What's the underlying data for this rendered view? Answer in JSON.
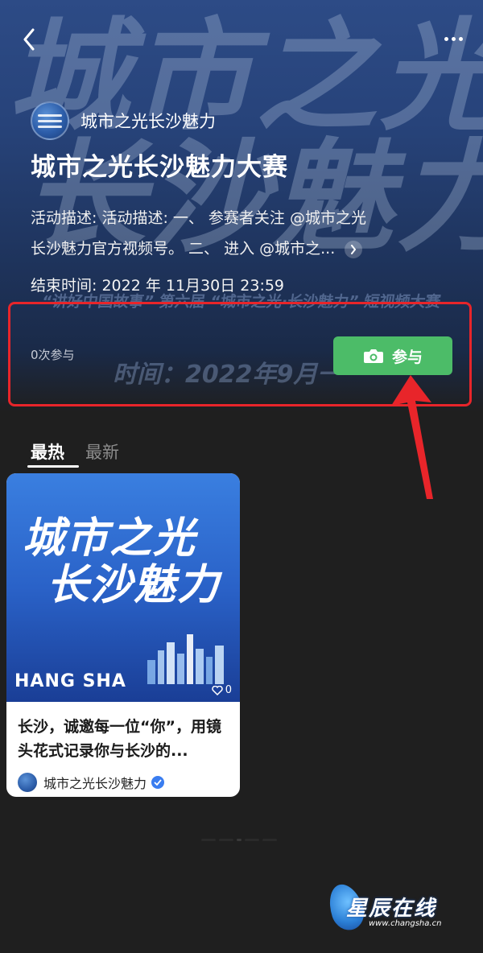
{
  "hero": {
    "bg_art_line1": "城市之光",
    "bg_art_line2": "长沙魅力",
    "bg_banner": "“讲好中国故事” 第六届 “城市之光·长沙魅力” 短视频大赛",
    "bg_time": "时间：2022年9月一"
  },
  "account": {
    "name": "城市之光长沙魅力"
  },
  "activity": {
    "title": "城市之光长沙魅力大赛",
    "description_line1": "活动描述: 活动描述: 一、 参赛者关注 @城市之光",
    "description_line2": "长沙魅力官方视频号。 二、 进入 @城市之...",
    "end_time": "结束时间: 2022 年 11月30日 23:59",
    "participants": "0次参与",
    "join_label": "参与"
  },
  "tabs": [
    {
      "label": "最热"
    },
    {
      "label": "最新"
    }
  ],
  "card": {
    "art_line1": "城市之光",
    "art_line2": "长沙魅力",
    "city_text": "HANG SHA",
    "likes": "0",
    "title": "长沙，诚邀每一位“你”，用镜头花式记录你与长沙的...",
    "author": "城市之光长沙魅力"
  },
  "watermark": {
    "brand": "星辰在线",
    "url": "www.changsha.cn"
  },
  "colors": {
    "accent_green": "#4cbc68",
    "highlight_red": "#e8252a",
    "verified_blue": "#3a7df0"
  }
}
